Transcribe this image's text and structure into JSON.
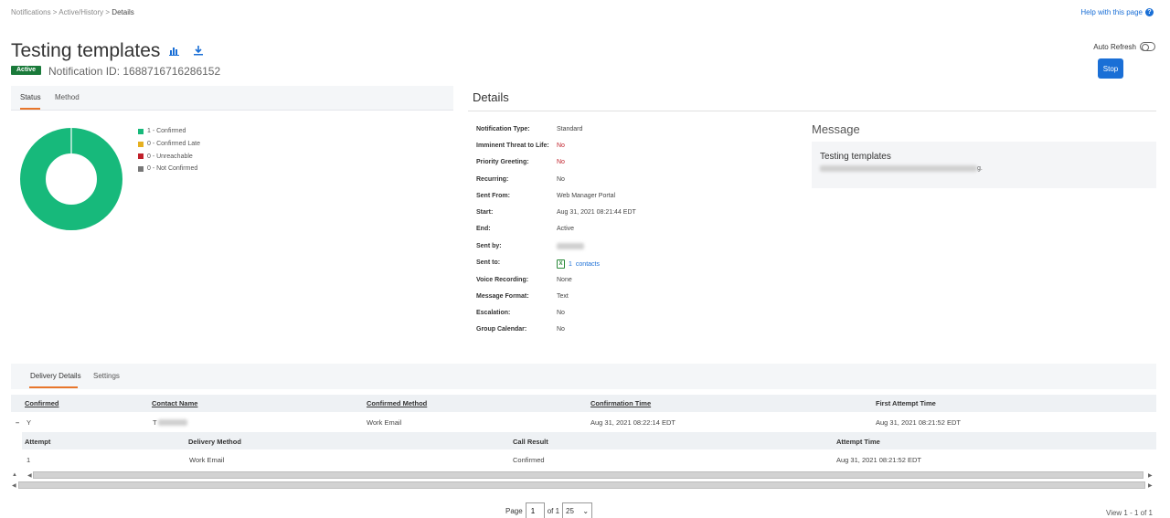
{
  "breadcrumb": {
    "items": [
      "Notifications",
      "Active/History"
    ],
    "current": "Details",
    "sep": " > "
  },
  "help": {
    "label": "Help with this page"
  },
  "header": {
    "title": "Testing templates",
    "status_badge": "Active",
    "notification_id": "Notification ID: 1688716716286152"
  },
  "auto_refresh": {
    "label": "Auto Refresh"
  },
  "stop_button": {
    "label": "Stop"
  },
  "status_tabs": [
    {
      "label": "Status"
    },
    {
      "label": "Method"
    }
  ],
  "donut": {
    "confirmed": 1,
    "confirmed_late": 0,
    "unreachable": 0,
    "not_confirmed": 0,
    "colors": [
      "#17b97b",
      "#e6b020",
      "#c0202a",
      "#777777"
    ]
  },
  "legend": [
    {
      "label": "1 - Confirmed",
      "color": "#17b97b"
    },
    {
      "label": "0 - Confirmed Late",
      "color": "#e6b020"
    },
    {
      "label": "0 - Unreachable",
      "color": "#c0202a"
    },
    {
      "label": "0 - Not Confirmed",
      "color": "#777777"
    }
  ],
  "details": {
    "title": "Details",
    "rows": [
      {
        "label": "Notification Type:",
        "value": "Standard"
      },
      {
        "label": "Imminent Threat to Life:",
        "value": "No"
      },
      {
        "label": "Priority Greeting:",
        "value": "No"
      },
      {
        "label": "Recurring:",
        "value": "No"
      },
      {
        "label": "Sent From:",
        "value": "Web Manager Portal"
      },
      {
        "label": "Start:",
        "value": "Aug 31, 2021 08:21:44 EDT"
      },
      {
        "label": "End:",
        "value": "Active"
      },
      {
        "label": "Sent by:",
        "value": ""
      },
      {
        "label": "Sent to:",
        "value": "1",
        "link": "contacts"
      },
      {
        "label": "Voice Recording:",
        "value": "None"
      },
      {
        "label": "Message Format:",
        "value": "Text"
      },
      {
        "label": "Escalation:",
        "value": "No"
      },
      {
        "label": "Group Calendar:",
        "value": "No"
      }
    ]
  },
  "message": {
    "title": "Message",
    "subject": "Testing templates",
    "body_suffix": "g."
  },
  "delivery_tabs": [
    {
      "label": "Delivery Details"
    },
    {
      "label": "Settings"
    }
  ],
  "table": {
    "columns": [
      "Confirmed",
      "Contact Name",
      "Confirmed Method",
      "Confirmation Time",
      "First Attempt Time"
    ],
    "row": {
      "toggle": "–",
      "confirmed": "Y",
      "contact_name": "T",
      "method": "Work Email",
      "confirmation_time": "Aug 31, 2021 08:22:14 EDT",
      "first_attempt": "Aug 31, 2021 08:21:52 EDT"
    },
    "sub_columns": [
      "Attempt",
      "Delivery Method",
      "Call Result",
      "Attempt Time"
    ],
    "sub_row": {
      "attempt": "1",
      "method": "Work Email",
      "result": "Confirmed",
      "time": "Aug 31, 2021 08:21:52 EDT"
    }
  },
  "pager": {
    "page_label": "Page",
    "page": "1",
    "of_label": "of 1",
    "page_size": "25",
    "view": "View 1 - 1 of 1"
  }
}
